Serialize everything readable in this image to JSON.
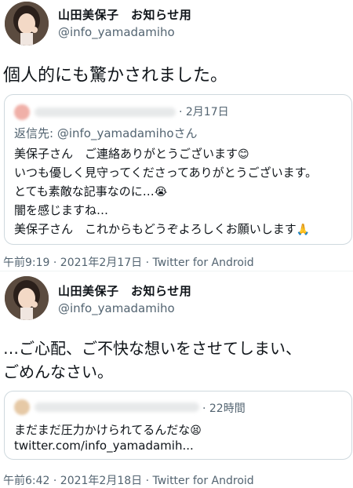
{
  "tweet1": {
    "display_name": "山田美保子　お知らせ用",
    "handle": "@info_yamadamiho",
    "text": "個人的にも驚かされました。",
    "quote": {
      "time": "· 2月17日",
      "reply_to": "返信先: @info_yamadamihoさん",
      "lines": [
        "美保子さん　ご連絡ありがとうございます",
        "いつも優しく見守ってくださってありがとうございます。",
        "とても素敵な記事なのに…",
        "闇を感じますね…",
        "美保子さん　これからもどうぞよろしくお願いします"
      ],
      "emojis": [
        "😊",
        "😭",
        "🙏"
      ]
    },
    "meta": "午前9:19 · 2021年2月17日 · Twitter for Android"
  },
  "tweet2": {
    "display_name": "山田美保子　お知らせ用",
    "handle": "@info_yamadamiho",
    "text_line1": "…ご心配、ご不快な想いをさせてしまい、",
    "text_line2": "ごめんなさい。",
    "quote": {
      "time": "· 22時間",
      "line1": "まだまだ圧力かけられてるんだな",
      "line2": "twitter.com/info_yamadamih...",
      "emoji": "😫"
    },
    "meta": "午前6:42 · 2021年2月18日 · Twitter for Android"
  },
  "colors": {
    "text": "#0f1419",
    "secondary": "#536471",
    "border": "#cfd9de"
  }
}
